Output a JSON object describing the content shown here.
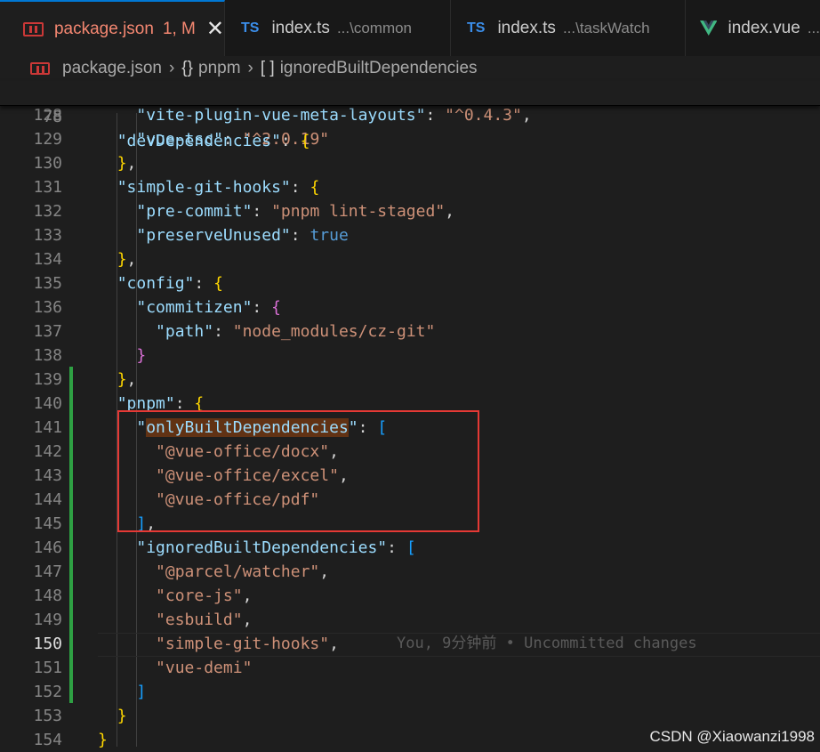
{
  "tabs": [
    {
      "label": "package.json",
      "status": "1, M",
      "icon": "npm-package-icon",
      "close": "✕",
      "active": true
    },
    {
      "label": "index.ts",
      "badge": "TS",
      "dir": "...\\common",
      "icon": "typescript-icon"
    },
    {
      "label": "index.ts",
      "badge": "TS",
      "dir": "...\\taskWatch",
      "icon": "typescript-icon"
    },
    {
      "label": "index.vue",
      "dir": "...",
      "icon": "vue-icon"
    }
  ],
  "breadcrumb": {
    "file": "package.json",
    "sep": "›",
    "obj_symbol": "{}",
    "obj": "pnpm",
    "arr_symbol": "[ ]",
    "arr": "ignoredBuiltDependencies"
  },
  "sticky": {
    "ln": "78",
    "key": "\"devDependencies\"",
    "colon": ": ",
    "open": "{"
  },
  "lines": [
    {
      "ln": "128",
      "t": [
        [
          "    ",
          "d"
        ],
        [
          "\"vite-plugin-vue-meta-layouts\"",
          "k"
        ],
        [
          ": ",
          "d"
        ],
        [
          "\"^0.4.3\"",
          "s"
        ],
        [
          ",",
          "d"
        ]
      ]
    },
    {
      "ln": "129",
      "t": [
        [
          "    ",
          "d"
        ],
        [
          "\"vue-tsc\"",
          "k"
        ],
        [
          ": ",
          "d"
        ],
        [
          "\"^2.0.19\"",
          "s"
        ]
      ]
    },
    {
      "ln": "130",
      "t": [
        [
          "  ",
          "d"
        ],
        [
          "}",
          "p1"
        ],
        [
          ",",
          "d"
        ]
      ]
    },
    {
      "ln": "131",
      "t": [
        [
          "  ",
          "d"
        ],
        [
          "\"simple-git-hooks\"",
          "k"
        ],
        [
          ": ",
          "d"
        ],
        [
          "{",
          "p1"
        ]
      ]
    },
    {
      "ln": "132",
      "t": [
        [
          "    ",
          "d"
        ],
        [
          "\"pre-commit\"",
          "k"
        ],
        [
          ": ",
          "d"
        ],
        [
          "\"pnpm lint-staged\"",
          "s"
        ],
        [
          ",",
          "d"
        ]
      ]
    },
    {
      "ln": "133",
      "t": [
        [
          "    ",
          "d"
        ],
        [
          "\"preserveUnused\"",
          "k"
        ],
        [
          ": ",
          "d"
        ],
        [
          "true",
          "b"
        ]
      ]
    },
    {
      "ln": "134",
      "t": [
        [
          "  ",
          "d"
        ],
        [
          "}",
          "p1"
        ],
        [
          ",",
          "d"
        ]
      ]
    },
    {
      "ln": "135",
      "t": [
        [
          "  ",
          "d"
        ],
        [
          "\"config\"",
          "k"
        ],
        [
          ": ",
          "d"
        ],
        [
          "{",
          "p1"
        ]
      ]
    },
    {
      "ln": "136",
      "t": [
        [
          "    ",
          "d"
        ],
        [
          "\"commitizen\"",
          "k"
        ],
        [
          ": ",
          "d"
        ],
        [
          "{",
          "p2"
        ]
      ]
    },
    {
      "ln": "137",
      "t": [
        [
          "      ",
          "d"
        ],
        [
          "\"path\"",
          "k"
        ],
        [
          ": ",
          "d"
        ],
        [
          "\"node_modules/cz-git\"",
          "s"
        ]
      ]
    },
    {
      "ln": "138",
      "t": [
        [
          "    ",
          "d"
        ],
        [
          "}",
          "p2"
        ]
      ]
    },
    {
      "ln": "139",
      "t": [
        [
          "  ",
          "d"
        ],
        [
          "}",
          "p1"
        ],
        [
          ",",
          "d"
        ]
      ]
    },
    {
      "ln": "140",
      "t": [
        [
          "  ",
          "d"
        ],
        [
          "\"pnpm\"",
          "k"
        ],
        [
          ": ",
          "d"
        ],
        [
          "{",
          "p1"
        ]
      ]
    },
    {
      "ln": "141",
      "t": [
        [
          "    ",
          "d"
        ],
        [
          "\"",
          "k"
        ],
        [
          "onlyBuiltDependencies",
          "k hl"
        ],
        [
          "\"",
          "k"
        ],
        [
          ": ",
          "d"
        ],
        [
          "[",
          "p3"
        ]
      ]
    },
    {
      "ln": "142",
      "t": [
        [
          "      ",
          "d"
        ],
        [
          "\"@vue-office/docx\"",
          "s"
        ],
        [
          ",",
          "d"
        ]
      ]
    },
    {
      "ln": "143",
      "t": [
        [
          "      ",
          "d"
        ],
        [
          "\"@vue-office/excel\"",
          "s"
        ],
        [
          ",",
          "d"
        ]
      ]
    },
    {
      "ln": "144",
      "t": [
        [
          "      ",
          "d"
        ],
        [
          "\"@vue-office/pdf\"",
          "s"
        ]
      ]
    },
    {
      "ln": "145",
      "t": [
        [
          "    ",
          "d"
        ],
        [
          "]",
          "p3"
        ],
        [
          ",",
          "d"
        ]
      ]
    },
    {
      "ln": "146",
      "t": [
        [
          "    ",
          "d"
        ],
        [
          "\"ignoredBuiltDependencies\"",
          "k"
        ],
        [
          ": ",
          "d"
        ],
        [
          "[",
          "p3"
        ]
      ]
    },
    {
      "ln": "147",
      "t": [
        [
          "      ",
          "d"
        ],
        [
          "\"@parcel/watcher\"",
          "s"
        ],
        [
          ",",
          "d"
        ]
      ]
    },
    {
      "ln": "148",
      "t": [
        [
          "      ",
          "d"
        ],
        [
          "\"core-js\"",
          "s"
        ],
        [
          ",",
          "d"
        ]
      ]
    },
    {
      "ln": "149",
      "t": [
        [
          "      ",
          "d"
        ],
        [
          "\"esbuild\"",
          "s"
        ],
        [
          ",",
          "d"
        ]
      ]
    },
    {
      "ln": "150",
      "current": true,
      "t": [
        [
          "      ",
          "d"
        ],
        [
          "\"simple-git-hooks\"",
          "s"
        ],
        [
          ",",
          "d"
        ]
      ],
      "blame": "You, 9分钟前 • Uncommitted changes"
    },
    {
      "ln": "151",
      "t": [
        [
          "      ",
          "d"
        ],
        [
          "\"vue-demi\"",
          "s"
        ]
      ]
    },
    {
      "ln": "152",
      "t": [
        [
          "    ",
          "d"
        ],
        [
          "]",
          "p3"
        ]
      ]
    },
    {
      "ln": "153",
      "t": [
        [
          "  ",
          "d"
        ],
        [
          "}",
          "p1"
        ]
      ]
    },
    {
      "ln": "154",
      "t": [
        [
          "}",
          "p1"
        ]
      ]
    }
  ],
  "watermark": "CSDN @Xiaowanzi1998",
  "colors": {
    "string": "#ce9178",
    "key": "#9cdcfe",
    "keyword": "#569cd6",
    "highlight_box": "#e53935",
    "git_added": "#2ea043"
  }
}
